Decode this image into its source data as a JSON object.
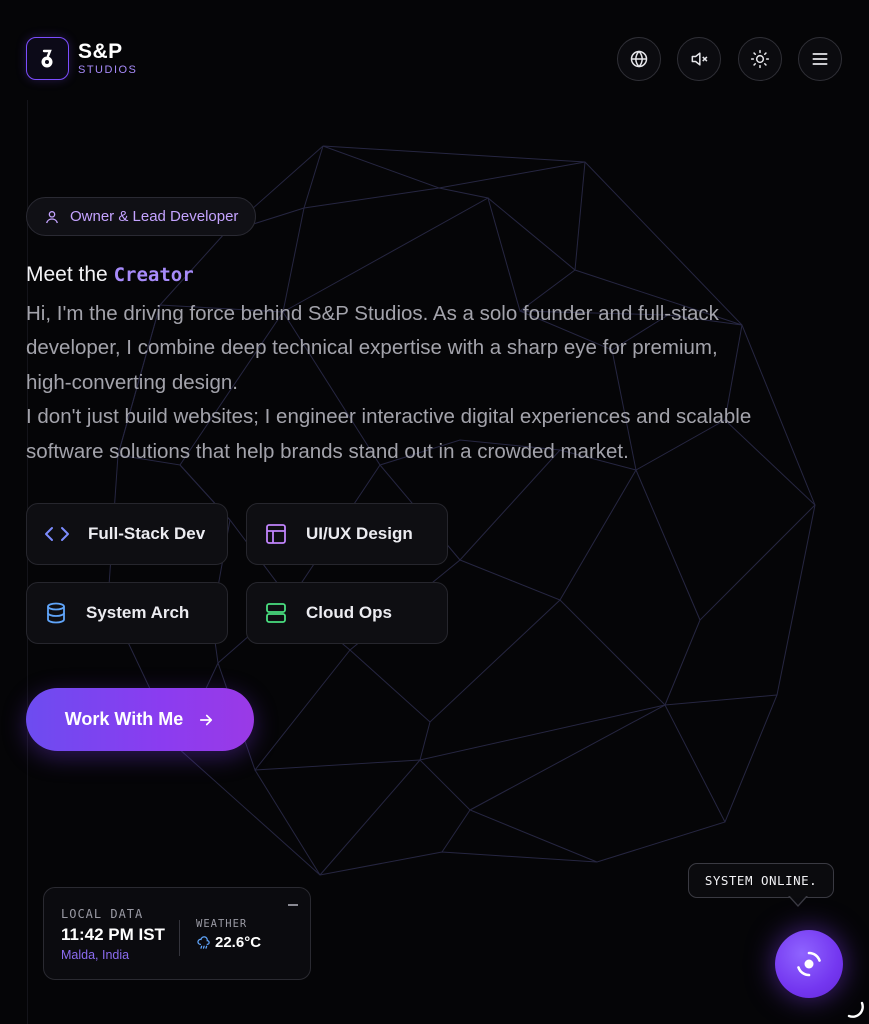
{
  "brand": {
    "title": "S&P",
    "subtitle": "STUDIOS"
  },
  "header_icons": [
    "globe-icon",
    "mute-icon",
    "sun-icon",
    "menu-icon"
  ],
  "badge": {
    "icon": "user-icon",
    "label": "Owner & Lead Developer"
  },
  "heading": {
    "prefix": "Meet the ",
    "accent": "Creator"
  },
  "intro": {
    "p1": "Hi, I'm the driving force behind S&P Studios. As a solo founder and full-stack developer, I combine deep technical expertise with a sharp eye for premium, high-converting design.",
    "p2": "I don't just build websites; I engineer interactive digital experiences and scalable software solutions that help brands stand out in a crowded market."
  },
  "skills": [
    {
      "label": "Full-Stack Dev",
      "icon": "code-icon",
      "color": "#7c8cff"
    },
    {
      "label": "UI/UX Design",
      "icon": "layout-icon",
      "color": "#c084fc"
    },
    {
      "label": "System Arch",
      "icon": "database-icon",
      "color": "#60a5fa"
    },
    {
      "label": "Cloud Ops",
      "icon": "server-icon",
      "color": "#4ade80"
    }
  ],
  "cta": {
    "label": "Work With Me",
    "icon": "arrow-right-icon"
  },
  "local_data": {
    "label": "LOCAL DATA",
    "time": "11:42 PM IST",
    "location": "Malda, India",
    "weather_label": "WEATHER",
    "weather_icon": "cloud-rain-icon",
    "temperature": "22.6°C"
  },
  "status": {
    "text": "SYSTEM ONLINE."
  },
  "colors": {
    "accent": "#7c3aed",
    "accent_light": "#a78bfa",
    "background": "#050507"
  }
}
